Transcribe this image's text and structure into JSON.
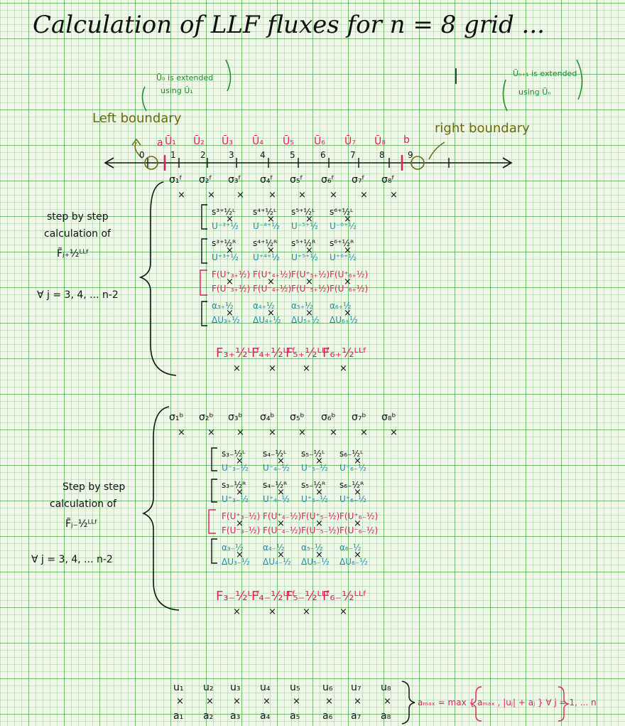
{
  "title": "Calculation of LLF fluxes for  n = 8  grid ...",
  "left_boundary": {
    "label": "Left boundary",
    "note_top": "Ū₀ is extended",
    "note_bottom": "using Ū₁"
  },
  "right_boundary": {
    "label": "right boundary",
    "note_top": "Ūₙ₊₁ is extended",
    "note_bottom": "using Ūₙ"
  },
  "axis": {
    "endpoints": [
      "a",
      "b"
    ],
    "cell_avgs": [
      "Ū₁",
      "Ū₂",
      "Ū₃",
      "Ū₄",
      "Ū₅",
      "Ū₆",
      "Ū₇",
      "Ū₈"
    ],
    "ticks": [
      "0",
      "1",
      "2",
      "3",
      "4",
      "5",
      "6",
      "7",
      "8",
      "9"
    ]
  },
  "top_block": {
    "sigmas": [
      "σ₁ᶠ",
      "σ₂ᶠ",
      "σ₃ᶠ",
      "σ₄ᶠ",
      "σ₅ᶠ",
      "σ₆ᶠ",
      "σ₇ᶠ",
      "σ₈ᶠ"
    ],
    "side_label": [
      "step by step",
      "calculation of",
      "F̃ⱼ₊½ᴸᴸᶠ"
    ],
    "range": "∀ j = 3, 4, ... n-2",
    "rows": [
      [
        "s³⁺½ᴸ",
        "s⁴⁺½ᴸ",
        "s⁵⁺½ᴸ",
        "s⁶⁺½ᴸ"
      ],
      [
        "U⁻³⁺½",
        "U⁻⁴⁺½",
        "U⁻⁵⁺½",
        "U⁻⁶⁺½"
      ],
      [
        "s³⁺½ᴿ",
        "s⁴⁺½ᴿ",
        "s⁵⁺½ᴿ",
        "s⁶⁺½ᴿ"
      ],
      [
        "U⁺³⁺½",
        "U⁺⁴⁺½",
        "U⁺⁵⁺½",
        "U⁺⁶⁺½"
      ],
      [
        "F(U⁺₃₊½)",
        "F(U⁺₄₊½)",
        "F(U⁺₅₊½)",
        "F(U⁺₆₊½)"
      ],
      [
        "F(U⁻₃₊½)",
        "F(U⁻₄₊½)",
        "F(U⁻₅₊½)",
        "F(U⁻₆₊½)"
      ],
      [
        "α₃₊½",
        "α₄₊½",
        "α₅₊½",
        "α₆₊½"
      ],
      [
        "ΔU₃₊½",
        "ΔU₄₊½",
        "ΔU₅₊½",
        "ΔU₆₊½"
      ]
    ],
    "fluxes": [
      "F₃₊½ᴸᴸᶠ",
      "F₄₊½ᴸᴸᶠ",
      "F₅₊½ᴸᴸᶠ",
      "F₆₊½ᴸᴸᶠ"
    ]
  },
  "bottom_block": {
    "sigmas": [
      "σ₁ᵇ",
      "σ₂ᵇ",
      "σ₃ᵇ",
      "σ₄ᵇ",
      "σ₅ᵇ",
      "σ₆ᵇ",
      "σ₇ᵇ",
      "σ₈ᵇ"
    ],
    "side_label": [
      "Step by step",
      "calculation of",
      "F̃ⱼ₋½ᴸᴸᶠ"
    ],
    "range": "∀ j = 3, 4, ... n-2",
    "rows": [
      [
        "s₃₋½ᴸ",
        "s₄₋½ᴸ",
        "s₅₋½ᴸ",
        "s₆₋½ᴸ"
      ],
      [
        "U⁻₃₋½",
        "U⁻₄₋½",
        "U⁻₅₋½",
        "U⁻₆₋½"
      ],
      [
        "s₃₋½ᴿ",
        "s₄₋½ᴿ",
        "s₅₋½ᴿ",
        "s₆₋½ᴿ"
      ],
      [
        "U⁺₃₋½",
        "U⁺₄₋½",
        "U⁺₅₋½",
        "U⁺₆₋½"
      ],
      [
        "F(U⁺₃₋½)",
        "F(U⁺₄₋½)",
        "F(U⁺₅₋½)",
        "F(U⁺₆₋½)"
      ],
      [
        "F(U⁻₃₋½)",
        "F(U⁻₄₋½)",
        "F(U⁻₅₋½)",
        "F(U⁻₆₋½)"
      ],
      [
        "α₃₋½",
        "α₄₋½",
        "α₅₋½",
        "α₆₋½"
      ],
      [
        "ΔU₃₋½",
        "ΔU₄₋½",
        "ΔU₅₋½",
        "ΔU₆₋½"
      ]
    ],
    "fluxes": [
      "F₃₋½ᴸᴸᶠ",
      "F₄₋½ᴸᴸᶠ",
      "F₅₋½ᴸᴸᶠ",
      "F₆₋½ᴸᴸᶠ"
    ]
  },
  "amax": {
    "u": [
      "u₁",
      "u₂",
      "u₃",
      "u₄",
      "u₅",
      "u₆",
      "u₇",
      "u₈"
    ],
    "a": [
      "a₁",
      "a₂",
      "a₃",
      "a₄",
      "a₅",
      "a₆",
      "a₇",
      "a₈"
    ],
    "formula": "aₘₐₓ = max { aₘₐₓ , |uⱼ| + aⱼ } ∀ j = 1, ... n"
  },
  "colors": {
    "ink": "#111111",
    "red": "#e0205a",
    "blue": "#1a8fb8",
    "green": "#1c8a2c",
    "olive": "#6b6a10",
    "grid": "#3c963c"
  }
}
